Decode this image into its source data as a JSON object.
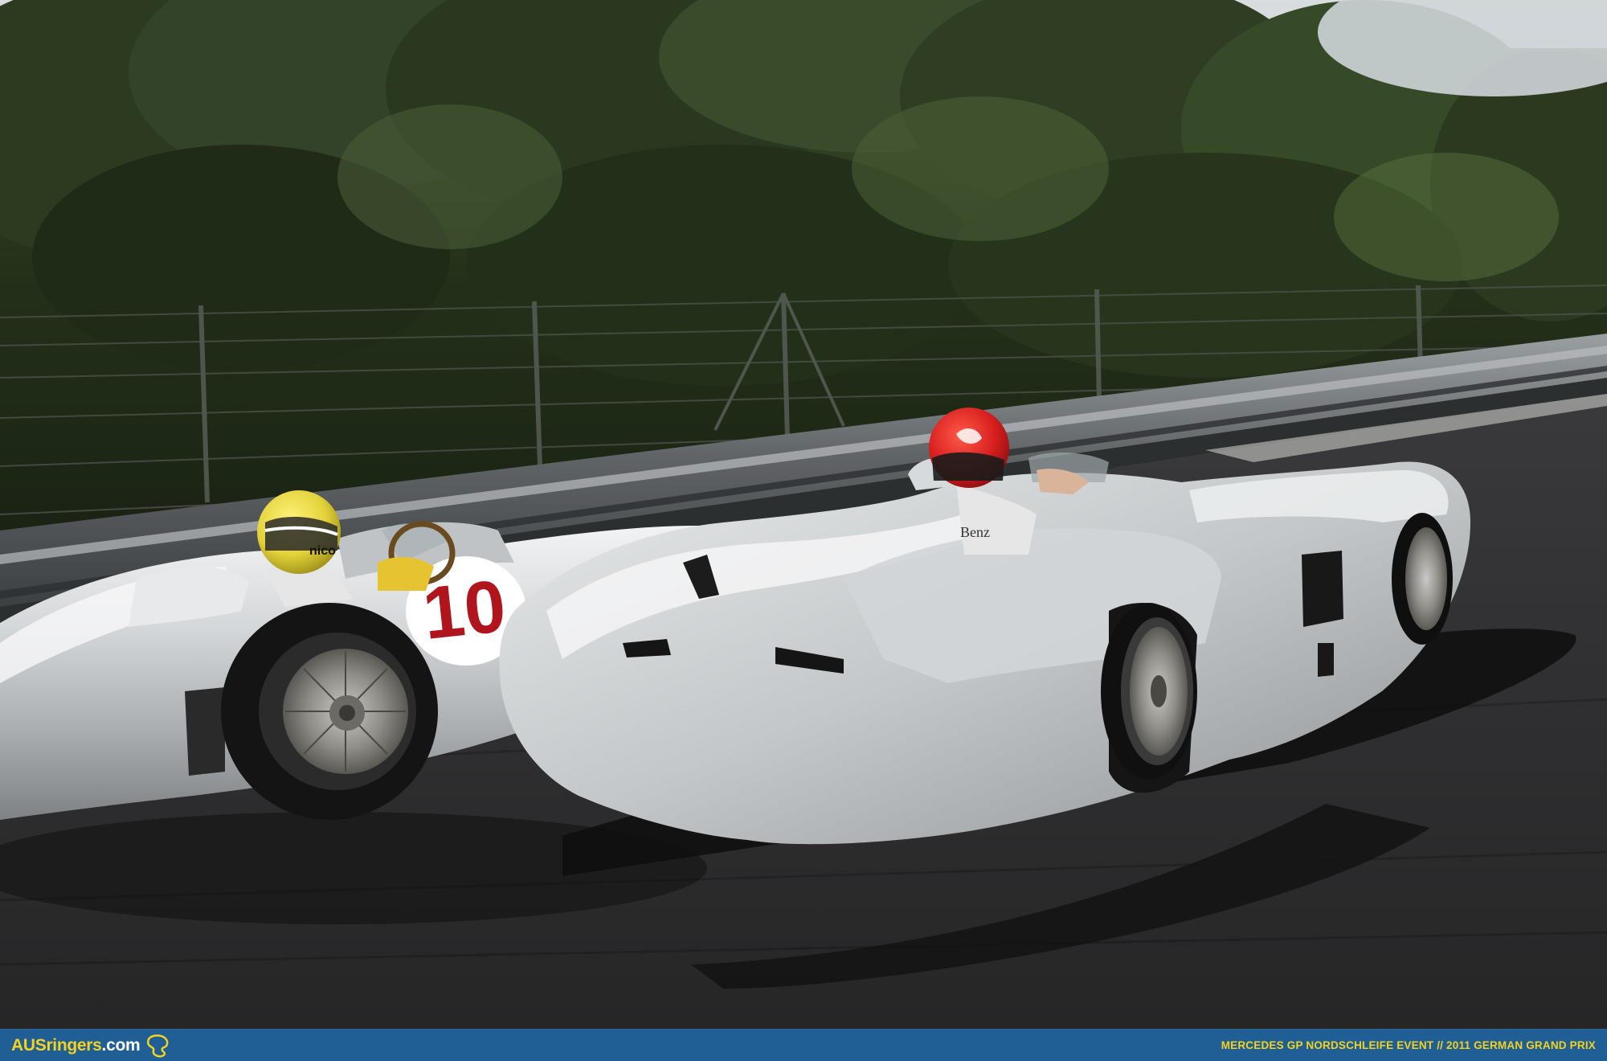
{
  "photo": {
    "subject": "Two vintage silver Mercedes racing cars on a track",
    "car_number": "10",
    "helmet_label": "nico",
    "livery_text": "Benz"
  },
  "footer": {
    "brand_part1": "AUSringers",
    "brand_part2": ".com",
    "caption": "MERCEDES GP NORDSCHLEIFE EVENT // 2011 GERMAN GRAND PRIX",
    "logo_icon": "nurburgring-track-icon"
  },
  "colors": {
    "footer_bg": "#1f5f96",
    "brand_yellow": "#f4d21f",
    "caption_yellow": "#f4d21f",
    "car_number_red": "#b0151e",
    "helmet_red": "#d81f1f",
    "helmet_yellow": "#e3d23a"
  }
}
